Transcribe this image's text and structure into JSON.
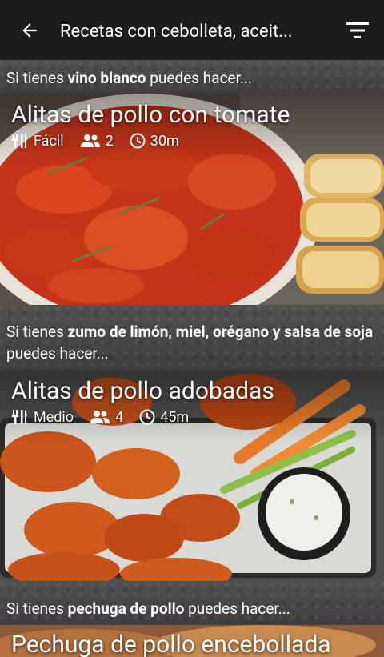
{
  "appbar": {
    "title": "Recetas con cebolleta, aceit...",
    "back_icon": "arrow-back-icon",
    "filter_icon": "filter-list-icon"
  },
  "sections": [
    {
      "hint_prefix": "Si tienes ",
      "hint_bold": "vino blanco",
      "hint_suffix": " puedes hacer...",
      "recipe": {
        "title": "Alitas de pollo con tomate",
        "difficulty": "Fácil",
        "servings": "2",
        "time": "30m"
      }
    },
    {
      "hint_prefix": "Si tienes ",
      "hint_bold": "zumo de limón, miel, orégano y salsa de soja",
      "hint_suffix": " puedes hacer...",
      "recipe": {
        "title": "Alitas de pollo adobadas",
        "difficulty": "Medio",
        "servings": "4",
        "time": "45m"
      }
    },
    {
      "hint_prefix": "Si tienes ",
      "hint_bold": "pechuga de pollo",
      "hint_suffix": " puedes hacer...",
      "recipe": {
        "title": "Pechuga de pollo encebollada"
      }
    }
  ],
  "colors": {
    "appbar_bg": "#1c1c1c",
    "text": "#ffffff"
  }
}
